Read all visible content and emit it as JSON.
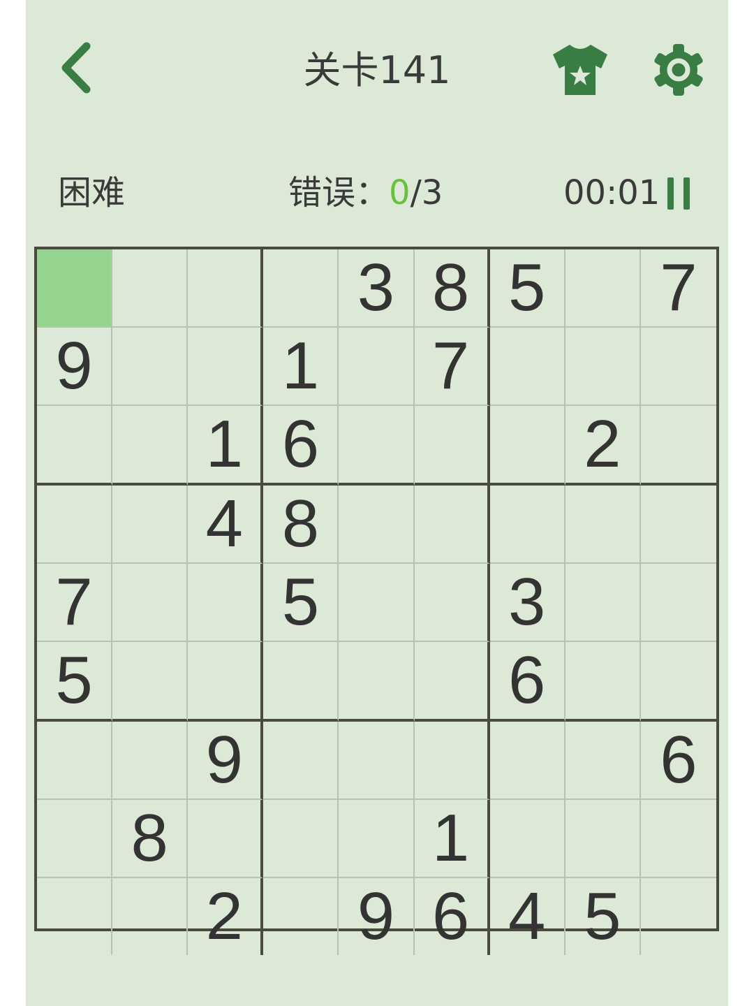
{
  "header": {
    "title": "关卡141",
    "back_icon": "chevron-left-icon",
    "shirt_icon": "shirt-star-icon",
    "settings_icon": "gear-icon"
  },
  "stats": {
    "difficulty": "困难",
    "errors_label": "错误：",
    "errors_count": "0",
    "errors_max": "/3",
    "timer": "00:01",
    "pause_icon": "pause-icon"
  },
  "colors": {
    "accent": "#3a7d44",
    "background": "#dbe9d6",
    "selected_cell": "#95d48c",
    "errors_ok": "#67c23a"
  },
  "board": {
    "selected": [
      0,
      0
    ],
    "rows": [
      [
        "",
        "",
        "",
        "",
        "3",
        "8",
        "5",
        "",
        "7"
      ],
      [
        "9",
        "",
        "",
        "1",
        "",
        "7",
        "",
        "",
        ""
      ],
      [
        "",
        "",
        "1",
        "6",
        "",
        "",
        "",
        "2",
        ""
      ],
      [
        "",
        "",
        "4",
        "8",
        "",
        "",
        "",
        "",
        ""
      ],
      [
        "7",
        "",
        "",
        "5",
        "",
        "",
        "3",
        "",
        ""
      ],
      [
        "5",
        "",
        "",
        "",
        "",
        "",
        "6",
        "",
        ""
      ],
      [
        "",
        "",
        "9",
        "",
        "",
        "",
        "",
        "",
        "6"
      ],
      [
        "",
        "8",
        "",
        "",
        "",
        "1",
        "",
        "",
        ""
      ],
      [
        "",
        "",
        "2",
        "",
        "9",
        "6",
        "4",
        "5",
        ""
      ]
    ]
  }
}
